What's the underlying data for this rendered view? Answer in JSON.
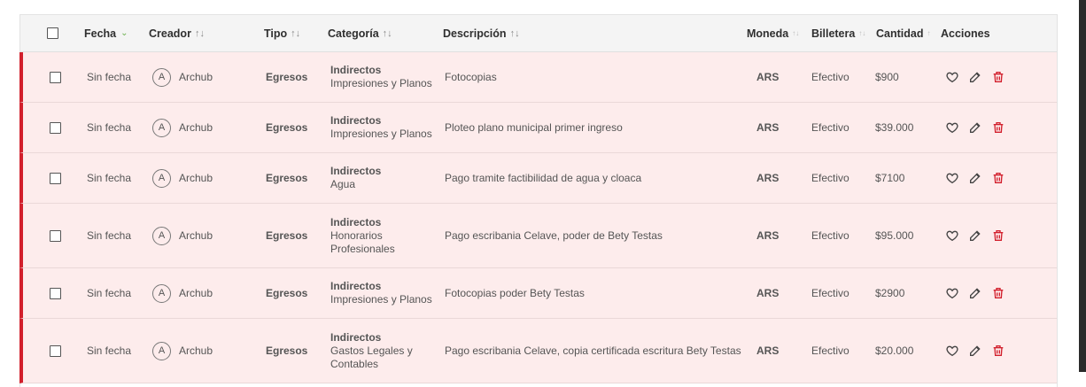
{
  "headers": {
    "fecha": "Fecha",
    "creador": "Creador",
    "tipo": "Tipo",
    "categoria": "Categoría",
    "descripcion": "Descripción",
    "moneda": "Moneda",
    "billetera": "Billetera",
    "cantidad": "Cantidad",
    "acciones": "Acciones"
  },
  "icons": {
    "sort": "sort-arrows-icon",
    "fecha_sort": "chevron-down-icon",
    "favorite": "heart-icon",
    "edit": "edit-icon",
    "delete": "trash-icon"
  },
  "colors": {
    "row_bg": "#fdecec",
    "row_accent": "#d21f2c",
    "delete": "#d21f2c",
    "sort_active": "#6ab04c"
  },
  "rows": [
    {
      "fecha": "Sin fecha",
      "avatar": "A",
      "creador": "Archub",
      "tipo": "Egresos",
      "cat_main": "Indirectos",
      "cat_sub": "Impresiones y Planos",
      "descripcion": "Fotocopias",
      "moneda": "ARS",
      "billetera": "Efectivo",
      "cantidad": "$900"
    },
    {
      "fecha": "Sin fecha",
      "avatar": "A",
      "creador": "Archub",
      "tipo": "Egresos",
      "cat_main": "Indirectos",
      "cat_sub": "Impresiones y Planos",
      "descripcion": "Ploteo plano municipal primer ingreso",
      "moneda": "ARS",
      "billetera": "Efectivo",
      "cantidad": "$39.000"
    },
    {
      "fecha": "Sin fecha",
      "avatar": "A",
      "creador": "Archub",
      "tipo": "Egresos",
      "cat_main": "Indirectos",
      "cat_sub": "Agua",
      "descripcion": "Pago tramite factibilidad de agua y cloaca",
      "moneda": "ARS",
      "billetera": "Efectivo",
      "cantidad": "$7100"
    },
    {
      "fecha": "Sin fecha",
      "avatar": "A",
      "creador": "Archub",
      "tipo": "Egresos",
      "cat_main": "Indirectos",
      "cat_sub": "Honorarios Profesionales",
      "descripcion": "Pago escribania Celave, poder de Bety Testas",
      "moneda": "ARS",
      "billetera": "Efectivo",
      "cantidad": "$95.000"
    },
    {
      "fecha": "Sin fecha",
      "avatar": "A",
      "creador": "Archub",
      "tipo": "Egresos",
      "cat_main": "Indirectos",
      "cat_sub": "Impresiones y Planos",
      "descripcion": "Fotocopias poder Bety Testas",
      "moneda": "ARS",
      "billetera": "Efectivo",
      "cantidad": "$2900"
    },
    {
      "fecha": "Sin fecha",
      "avatar": "A",
      "creador": "Archub",
      "tipo": "Egresos",
      "cat_main": "Indirectos",
      "cat_sub": "Gastos Legales y Contables",
      "descripcion": "Pago escribania Celave, copia certificada escritura Bety Testas",
      "moneda": "ARS",
      "billetera": "Efectivo",
      "cantidad": "$20.000"
    }
  ]
}
